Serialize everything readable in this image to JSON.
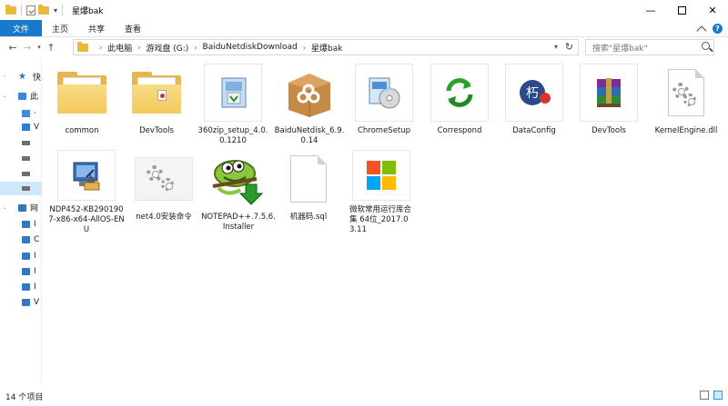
{
  "window": {
    "title": "星爆bak",
    "minimize": "—",
    "maximize": "",
    "close": "✕"
  },
  "ribbon": {
    "tabs": [
      "文件",
      "主页",
      "共享",
      "查看"
    ]
  },
  "address": {
    "crumbs": [
      "此电脑",
      "游戏盘 (G:)",
      "BaiduNetdiskDownload",
      "星爆bak"
    ],
    "search_placeholder": "搜索\"星爆bak\""
  },
  "navpane": {
    "items": [
      {
        "label": "快",
        "icon": "star-icon"
      },
      {
        "label": "此",
        "icon": "pc-icon"
      },
      {
        "label": "·",
        "icon": "video-icon"
      },
      {
        "label": "V",
        "icon": "drive-icon"
      },
      {
        "label": "",
        "icon": "drive-icon"
      },
      {
        "label": "",
        "icon": "drive-icon"
      },
      {
        "label": "",
        "icon": "drive-icon"
      },
      {
        "label": "",
        "icon": "drive-icon"
      },
      {
        "label": "网",
        "icon": "network-icon"
      },
      {
        "label": "I",
        "icon": "computer-icon"
      },
      {
        "label": "C",
        "icon": "computer-icon"
      },
      {
        "label": "I",
        "icon": "computer-icon"
      },
      {
        "label": "I",
        "icon": "computer-icon"
      },
      {
        "label": "I",
        "icon": "computer-icon"
      },
      {
        "label": "V",
        "icon": "computer-icon"
      }
    ]
  },
  "files": [
    {
      "name": "common",
      "kind": "folder"
    },
    {
      "name": "DevTools",
      "kind": "folder-doc"
    },
    {
      "name": "360zip_setup_4.0.0.1210",
      "kind": "installer"
    },
    {
      "name": "BaiduNetdisk_6.9.0.14",
      "kind": "baidu-box"
    },
    {
      "name": "ChromeSetup",
      "kind": "setup-cd"
    },
    {
      "name": "Correspond",
      "kind": "green-arrows"
    },
    {
      "name": "DataConfig",
      "kind": "dataconfig"
    },
    {
      "name": "DevTools",
      "kind": "rar"
    },
    {
      "name": "KernelEngine.dll",
      "kind": "dll"
    },
    {
      "name": "NDP452-KB2901907-x86-x64-AllOS-ENU",
      "kind": "ndp"
    },
    {
      "name": "net4.0安装命令",
      "kind": "gear-file"
    },
    {
      "name": "NOTEPAD++.7.5.6.Installer",
      "kind": "notepadpp"
    },
    {
      "name": "机器码.sql",
      "kind": "blank"
    },
    {
      "name": "微软常用运行库合集 64位_2017.03.11",
      "kind": "windows-logo"
    }
  ],
  "status": {
    "count_text": "14 个项目"
  },
  "colors": {
    "accent": "#1979ca",
    "folder": "#e7b54a",
    "selection": "#cde8ff"
  }
}
